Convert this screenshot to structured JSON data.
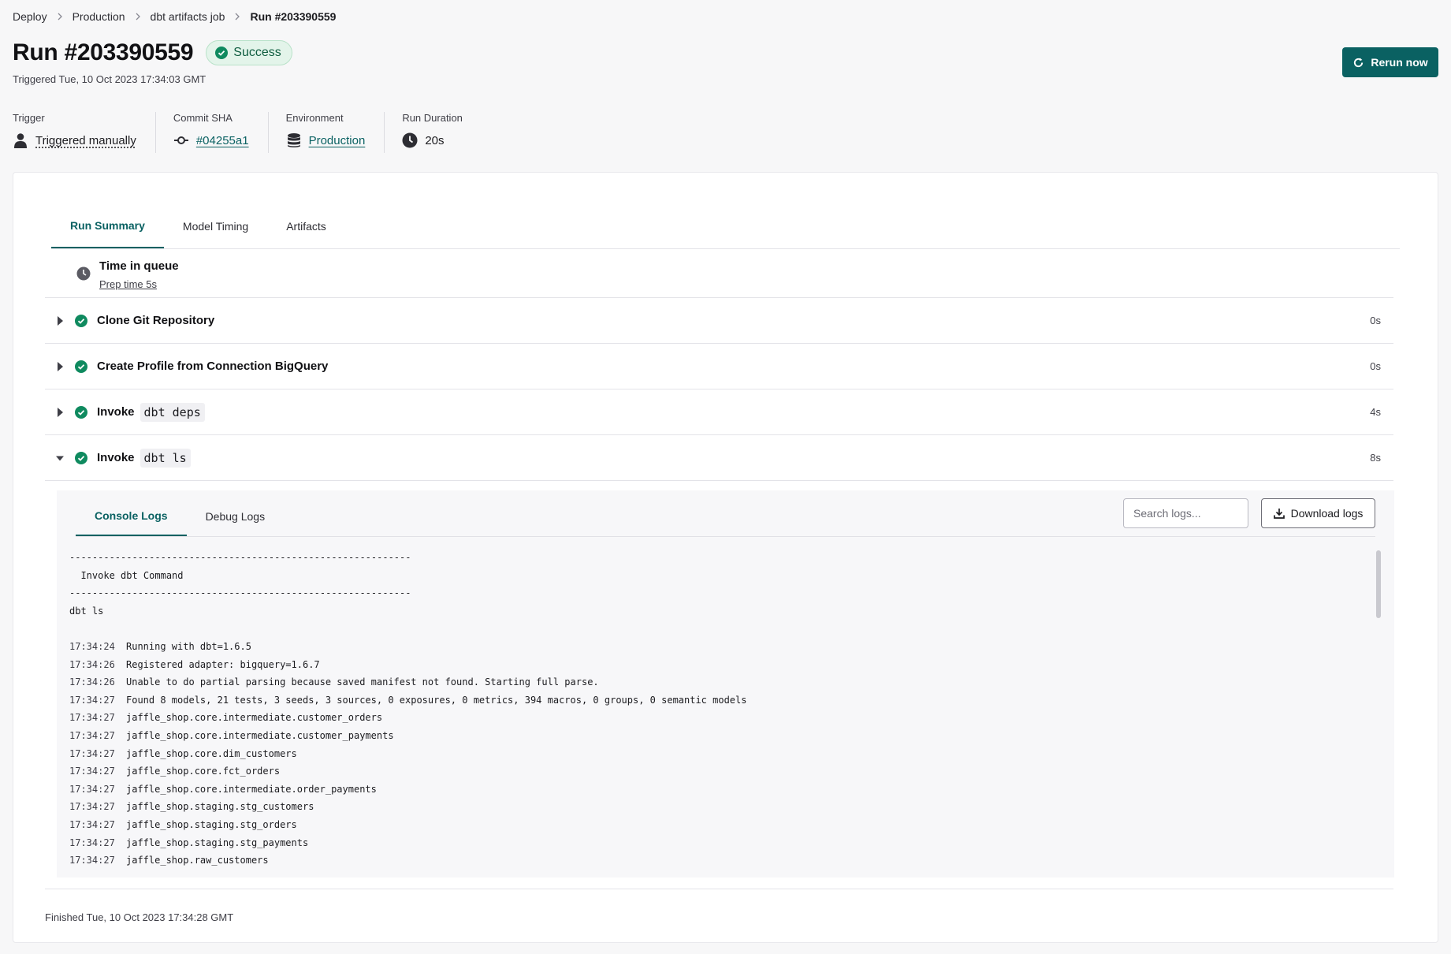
{
  "breadcrumb": {
    "items": [
      "Deploy",
      "Production",
      "dbt artifacts job"
    ],
    "current": "Run #203390559"
  },
  "header": {
    "title": "Run #203390559",
    "status": "Success",
    "triggered_at": "Triggered Tue, 10 Oct 2023 17:34:03 GMT",
    "rerun_label": "Rerun now"
  },
  "meta": {
    "trigger": {
      "label": "Trigger",
      "value": "Triggered manually"
    },
    "commit": {
      "label": "Commit SHA",
      "value": "#04255a1"
    },
    "environment": {
      "label": "Environment",
      "value": "Production"
    },
    "duration": {
      "label": "Run Duration",
      "value": "20s"
    }
  },
  "tabs": [
    "Run Summary",
    "Model Timing",
    "Artifacts"
  ],
  "queue": {
    "title": "Time in queue",
    "subtitle": "Prep time 5s"
  },
  "steps": [
    {
      "pre": "Clone Git Repository",
      "code": "",
      "time": "0s"
    },
    {
      "pre": "Create Profile from Connection BigQuery",
      "code": "",
      "time": "0s"
    },
    {
      "pre": "Invoke",
      "code": "dbt deps",
      "time": "4s"
    },
    {
      "pre": "Invoke",
      "code": "dbt ls",
      "time": "8s"
    }
  ],
  "logs": {
    "tabs": [
      "Console Logs",
      "Debug Logs"
    ],
    "search_placeholder": "Search logs...",
    "download_label": "Download logs",
    "header_lines": [
      "------------------------------------------------------------",
      "  Invoke dbt Command",
      "------------------------------------------------------------",
      "dbt ls",
      ""
    ],
    "entries": [
      {
        "ts": "17:34:24",
        "msg": "Running with dbt=1.6.5"
      },
      {
        "ts": "17:34:26",
        "msg": "Registered adapter: bigquery=1.6.7"
      },
      {
        "ts": "17:34:26",
        "msg": "Unable to do partial parsing because saved manifest not found. Starting full parse."
      },
      {
        "ts": "17:34:27",
        "msg": "Found 8 models, 21 tests, 3 seeds, 3 sources, 0 exposures, 0 metrics, 394 macros, 0 groups, 0 semantic models"
      },
      {
        "ts": "17:34:27",
        "msg": "jaffle_shop.core.intermediate.customer_orders"
      },
      {
        "ts": "17:34:27",
        "msg": "jaffle_shop.core.intermediate.customer_payments"
      },
      {
        "ts": "17:34:27",
        "msg": "jaffle_shop.core.dim_customers"
      },
      {
        "ts": "17:34:27",
        "msg": "jaffle_shop.core.fct_orders"
      },
      {
        "ts": "17:34:27",
        "msg": "jaffle_shop.core.intermediate.order_payments"
      },
      {
        "ts": "17:34:27",
        "msg": "jaffle_shop.staging.stg_customers"
      },
      {
        "ts": "17:34:27",
        "msg": "jaffle_shop.staging.stg_orders"
      },
      {
        "ts": "17:34:27",
        "msg": "jaffle_shop.staging.stg_payments"
      },
      {
        "ts": "17:34:27",
        "msg": "jaffle_shop.raw_customers"
      }
    ]
  },
  "finished": "Finished Tue, 10 Oct 2023 17:34:28 GMT",
  "colors": {
    "accent": "#0a6162",
    "success": "#0f8a5f"
  }
}
